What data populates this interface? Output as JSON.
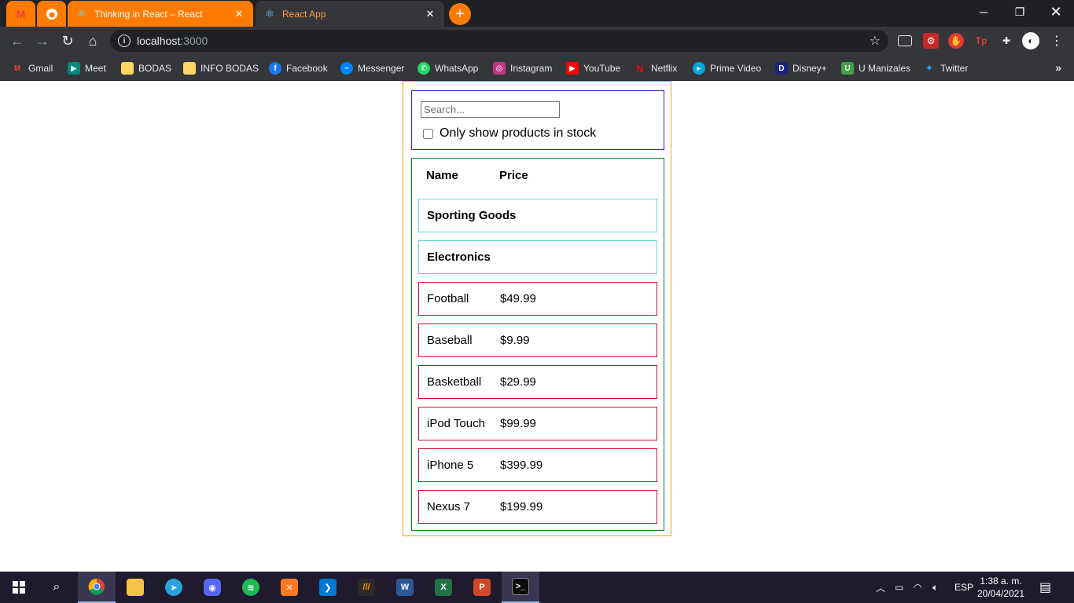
{
  "browser": {
    "tabs": [
      {
        "title": "Thinking in React – React",
        "active": false
      },
      {
        "title": "React App",
        "active": true
      }
    ],
    "new_tab_label": "+",
    "close_glyph": "✕",
    "address": {
      "host": "localhost",
      "port": ":3000"
    },
    "bookmarks": [
      "Gmail",
      "Meet",
      "BODAS",
      "INFO BODAS",
      "Facebook",
      "Messenger",
      "WhatsApp",
      "Instagram",
      "YouTube",
      "Netflix",
      "Prime Video",
      "Disney+",
      "U Manizales",
      "Twitter"
    ],
    "overflow_glyph": "»",
    "accent_color": "#ff7b00"
  },
  "app": {
    "search": {
      "placeholder": "Search...",
      "value": ""
    },
    "in_stock_label": "Only show products in stock",
    "in_stock_checked": false,
    "table": {
      "headers": {
        "name": "Name",
        "price": "Price"
      },
      "categories": [
        "Sporting Goods",
        "Electronics"
      ],
      "products": [
        {
          "name": "Football",
          "price": "$49.99"
        },
        {
          "name": "Baseball",
          "price": "$9.99"
        },
        {
          "name": "Basketball",
          "price": "$29.99"
        },
        {
          "name": "iPod Touch",
          "price": "$99.99"
        },
        {
          "name": "iPhone 5",
          "price": "$399.99"
        },
        {
          "name": "Nexus 7",
          "price": "$199.99"
        }
      ]
    }
  },
  "taskbar": {
    "language": "ESP",
    "time": "1:38 a. m.",
    "date": "20/04/2021",
    "apps": [
      "windows-start",
      "search",
      "chrome",
      "file-explorer",
      "telegram",
      "discord",
      "spotify",
      "xampp",
      "vscode",
      "sublime",
      "word",
      "excel",
      "powerpoint",
      "terminal"
    ]
  }
}
